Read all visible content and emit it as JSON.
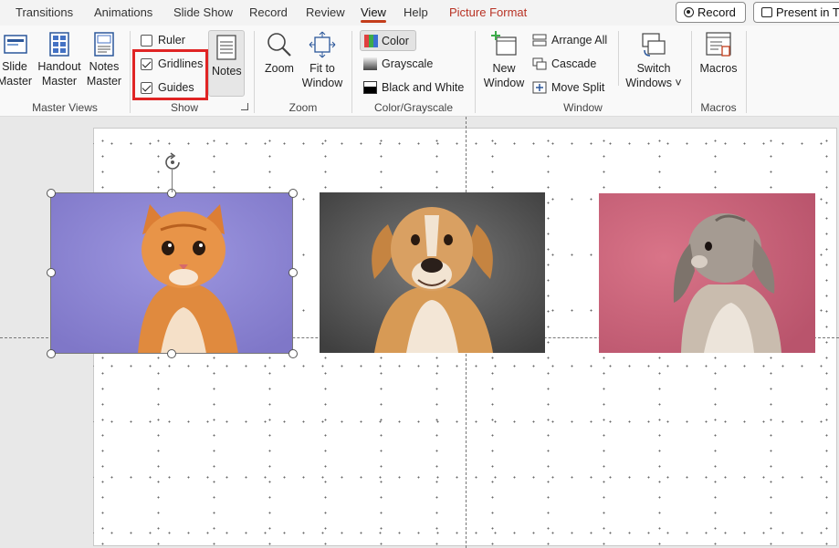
{
  "tabs": [
    {
      "label": "Transitions",
      "state": "normal"
    },
    {
      "label": "Animations",
      "state": "normal"
    },
    {
      "label": "Slide Show",
      "state": "normal"
    },
    {
      "label": "Record",
      "state": "normal"
    },
    {
      "label": "Review",
      "state": "normal"
    },
    {
      "label": "View",
      "state": "active"
    },
    {
      "label": "Help",
      "state": "normal"
    },
    {
      "label": "Picture Format",
      "state": "contextual"
    }
  ],
  "top_buttons": {
    "record": "Record",
    "present": "Present in Te"
  },
  "ribbon": {
    "master_views": {
      "slide_master_1": "Slide",
      "slide_master_2": "Master",
      "handout_master_1": "Handout",
      "handout_master_2": "Master",
      "notes_master_1": "Notes",
      "notes_master_2": "Master",
      "group_label": "Master Views"
    },
    "show": {
      "ruler": "Ruler",
      "ruler_checked": false,
      "gridlines": "Gridlines",
      "gridlines_checked": true,
      "guides": "Guides",
      "guides_checked": true,
      "notes": "Notes",
      "group_label": "Show"
    },
    "zoom": {
      "zoom": "Zoom",
      "fit_1": "Fit to",
      "fit_2": "Window",
      "group_label": "Zoom"
    },
    "color_grayscale": {
      "color": "Color",
      "grayscale": "Grayscale",
      "black_white": "Black and White",
      "group_label": "Color/Grayscale"
    },
    "window": {
      "new_1": "New",
      "new_2": "Window",
      "arrange_all": "Arrange All",
      "cascade": "Cascade",
      "move_split": "Move Split",
      "switch_1": "Switch",
      "switch_2": "Windows ˅",
      "group_label": "Window"
    },
    "macros": {
      "macros": "Macros",
      "group_label": "Macros"
    }
  },
  "colors": {
    "accent": "#c43e1c",
    "contextual_tab": "#b83224",
    "highlight": "#e02424"
  },
  "slide": {
    "images": [
      {
        "name": "kitten-photo",
        "background": "#8d86d6"
      },
      {
        "name": "dog-photo",
        "background": "#5a5a5a"
      },
      {
        "name": "rabbit-photo",
        "background": "#c8627a"
      }
    ]
  }
}
